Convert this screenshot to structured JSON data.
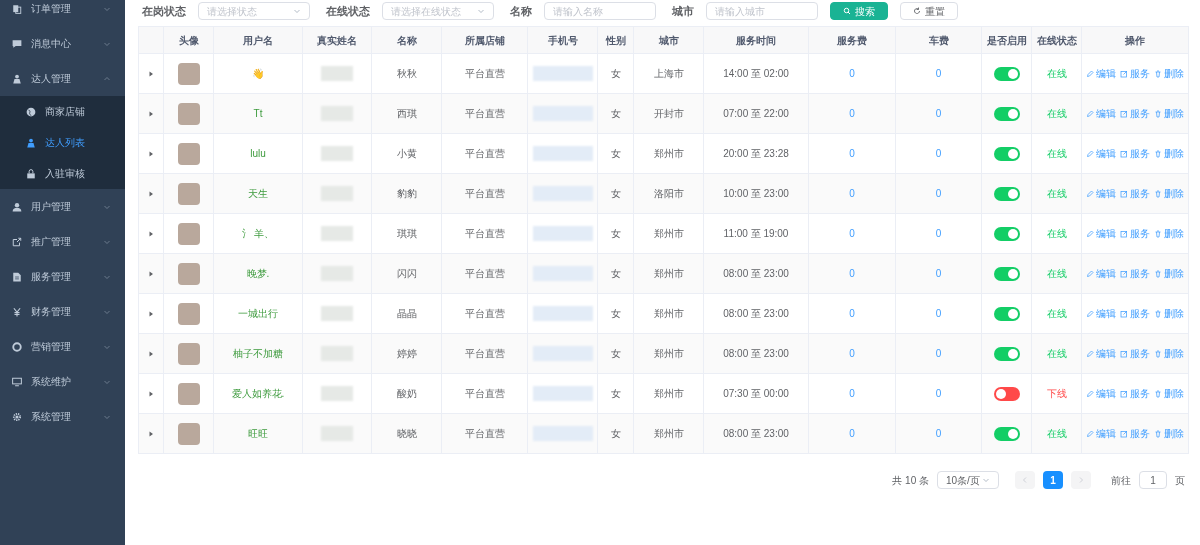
{
  "sidebar": {
    "items": [
      {
        "label": "订单管理",
        "expanded": false
      },
      {
        "label": "消息中心",
        "expanded": false
      },
      {
        "label": "达人管理",
        "expanded": true,
        "children": [
          {
            "label": "商家店铺",
            "selected": false
          },
          {
            "label": "达人列表",
            "selected": true
          },
          {
            "label": "入驻审核",
            "selected": false
          }
        ]
      },
      {
        "label": "用户管理",
        "expanded": false
      },
      {
        "label": "推广管理",
        "expanded": false
      },
      {
        "label": "服务管理",
        "expanded": false
      },
      {
        "label": "财务管理",
        "expanded": false
      },
      {
        "label": "营销管理",
        "expanded": false
      },
      {
        "label": "系统维护",
        "expanded": false
      },
      {
        "label": "系统管理",
        "expanded": false
      }
    ]
  },
  "filters": [
    {
      "kind": "select",
      "label": "在岗状态",
      "placeholder": "请选择状态"
    },
    {
      "kind": "select",
      "label": "在线状态",
      "placeholder": "请选择在线状态"
    },
    {
      "kind": "input",
      "label": "名称",
      "placeholder": "请输入名称"
    },
    {
      "kind": "input",
      "label": "城市",
      "placeholder": "请输入城市"
    }
  ],
  "filter_buttons": [
    {
      "kind": "primary",
      "label": "搜索"
    },
    {
      "kind": "default",
      "label": "重置"
    }
  ],
  "table": {
    "columns": [
      "头像",
      "用户名",
      "真实姓名",
      "名称",
      "所属店铺",
      "手机号",
      "性别",
      "城市",
      "服务时间",
      "服务费",
      "车费",
      "是否启用",
      "在线状态",
      "操作"
    ],
    "rows": [
      {
        "username": "👋",
        "name": "秋秋",
        "store": "平台直营",
        "gender": "女",
        "city": "上海市",
        "service_time": "14:00 至 02:00",
        "service_fee": "0",
        "car_fee": "0",
        "enabled": true,
        "online": true,
        "online_status": "在线",
        "actions": [
          "编辑",
          "服务",
          "删除"
        ]
      },
      {
        "username": "Tt",
        "name": "西琪",
        "store": "平台直营",
        "gender": "女",
        "city": "开封市",
        "service_time": "07:00 至 22:00",
        "service_fee": "0",
        "car_fee": "0",
        "enabled": true,
        "online": true,
        "online_status": "在线",
        "actions": [
          "编辑",
          "服务",
          "删除"
        ]
      },
      {
        "username": "lulu",
        "name": "小黄",
        "store": "平台直营",
        "gender": "女",
        "city": "郑州市",
        "service_time": "20:00 至 23:28",
        "service_fee": "0",
        "car_fee": "0",
        "enabled": true,
        "online": true,
        "online_status": "在线",
        "actions": [
          "编辑",
          "服务",
          "删除"
        ]
      },
      {
        "username": "天生",
        "name": "豹豹",
        "store": "平台直营",
        "gender": "女",
        "city": "洛阳市",
        "service_time": "10:00 至 23:00",
        "service_fee": "0",
        "car_fee": "0",
        "enabled": true,
        "online": true,
        "online_status": "在线",
        "actions": [
          "编辑",
          "服务",
          "删除"
        ]
      },
      {
        "username": "氵 羊、",
        "name": "琪琪",
        "store": "平台直营",
        "gender": "女",
        "city": "郑州市",
        "service_time": "11:00 至 19:00",
        "service_fee": "0",
        "car_fee": "0",
        "enabled": true,
        "online": true,
        "online_status": "在线",
        "actions": [
          "编辑",
          "服务",
          "删除"
        ]
      },
      {
        "username": "晚梦.",
        "name": "闪闪",
        "store": "平台直营",
        "gender": "女",
        "city": "郑州市",
        "service_time": "08:00 至 23:00",
        "service_fee": "0",
        "car_fee": "0",
        "enabled": true,
        "online": true,
        "online_status": "在线",
        "actions": [
          "编辑",
          "服务",
          "删除"
        ]
      },
      {
        "username": "一城出行",
        "name": "晶晶",
        "store": "平台直营",
        "gender": "女",
        "city": "郑州市",
        "service_time": "08:00 至 23:00",
        "service_fee": "0",
        "car_fee": "0",
        "enabled": true,
        "online": true,
        "online_status": "在线",
        "actions": [
          "编辑",
          "服务",
          "删除"
        ]
      },
      {
        "username": "柚子不加糖",
        "name": "婷婷",
        "store": "平台直营",
        "gender": "女",
        "city": "郑州市",
        "service_time": "08:00 至 23:00",
        "service_fee": "0",
        "car_fee": "0",
        "enabled": true,
        "online": true,
        "online_status": "在线",
        "actions": [
          "编辑",
          "服务",
          "删除"
        ]
      },
      {
        "username": "爱人如养花.",
        "name": "酸奶",
        "store": "平台直营",
        "gender": "女",
        "city": "郑州市",
        "service_time": "07:30 至 00:00",
        "service_fee": "0",
        "car_fee": "0",
        "enabled": false,
        "online": false,
        "online_status": "下线",
        "actions": [
          "编辑",
          "服务",
          "删除"
        ]
      },
      {
        "username": "旺旺",
        "name": "晓晓",
        "store": "平台直营",
        "gender": "女",
        "city": "郑州市",
        "service_time": "08:00 至 23:00",
        "service_fee": "0",
        "car_fee": "0",
        "enabled": true,
        "online": true,
        "online_status": "在线",
        "actions": [
          "编辑",
          "服务",
          "删除"
        ]
      }
    ]
  },
  "pagination": {
    "total": "共 10 条",
    "page_size": "10条/页",
    "pages": [
      {
        "label": "1",
        "selected": true
      }
    ],
    "goto_label": "前往",
    "goto_value": "1",
    "goto_suffix": "页"
  }
}
